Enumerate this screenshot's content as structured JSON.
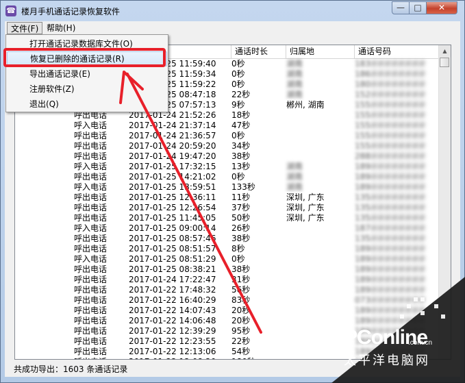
{
  "window": {
    "title": "楼月手机通话记录恢复软件",
    "app_icon": "phone-app-icon"
  },
  "window_controls": {
    "minimize": "—",
    "maximize": "□",
    "close": "✕"
  },
  "menubar": {
    "file": "文件(F)",
    "help": "帮助(H)"
  },
  "file_menu": {
    "items": [
      {
        "label": "打开通话记录数据库文件(O)"
      },
      {
        "label": "恢复已删除的通话记录(R)"
      },
      {
        "label": "导出通话记录(E)"
      },
      {
        "label": "注册软件(Z)"
      },
      {
        "label": "退出(Q)"
      }
    ],
    "highlighted_index": 1
  },
  "table": {
    "columns": [
      "通话时长",
      "归属地",
      "通话号码"
    ],
    "rows": [
      {
        "type": "",
        "time": "2017-01-25 11:59:40",
        "duration": "0秒",
        "location": "湖南",
        "number": "183"
      },
      {
        "type": "",
        "time": "2017-01-25 11:59:34",
        "duration": "0秒",
        "location": "湖南",
        "number": "186"
      },
      {
        "type": "",
        "time": "2017-01-25 11:59:22",
        "duration": "0秒",
        "location": "湖南",
        "number": "180"
      },
      {
        "type": "",
        "time": "2017-01-25 08:47:18",
        "duration": "22秒",
        "location": "湖南",
        "number": "152"
      },
      {
        "type": "",
        "time": "2017-01-25 07:57:13",
        "duration": "9秒",
        "location": "郴州, 湖南",
        "number": "155"
      },
      {
        "type": "呼出电话",
        "time": "2017-01-24 21:52:26",
        "duration": "18秒",
        "location": "",
        "number": "155"
      },
      {
        "type": "呼入电话",
        "time": "2017-01-24 21:37:14",
        "duration": "47秒",
        "location": "",
        "number": "155"
      },
      {
        "type": "呼出电话",
        "time": "2017-01-24 21:36:57",
        "duration": "0秒",
        "location": "",
        "number": "155"
      },
      {
        "type": "呼出电话",
        "time": "2017-01-24 20:59:20",
        "duration": "34秒",
        "location": "",
        "number": "155"
      },
      {
        "type": "呼出电话",
        "time": "2017-01-24 19:47:20",
        "duration": "38秒",
        "location": "",
        "number": "288"
      },
      {
        "type": "呼入电话",
        "time": "2017-01-25 17:32:15",
        "duration": "13秒",
        "location": "湖南",
        "number": "189"
      },
      {
        "type": "呼出电话",
        "time": "2017-01-25 14:21:02",
        "duration": "0秒",
        "location": "湖南",
        "number": "189"
      },
      {
        "type": "呼入电话",
        "time": "2017-01-25 13:59:51",
        "duration": "133秒",
        "location": "湖南",
        "number": "189"
      },
      {
        "type": "呼出电话",
        "time": "2017-01-25 12:36:11",
        "duration": "11秒",
        "location": "深圳, 广东",
        "number": "135"
      },
      {
        "type": "呼出电话",
        "time": "2017-01-25 12:26:54",
        "duration": "37秒",
        "location": "深圳, 广东",
        "number": "135"
      },
      {
        "type": "呼出电话",
        "time": "2017-01-25 11:45:05",
        "duration": "50秒",
        "location": "深圳, 广东",
        "number": "135"
      },
      {
        "type": "呼入电话",
        "time": "2017-01-25 09:00:14",
        "duration": "26秒",
        "location": "",
        "number": "187"
      },
      {
        "type": "呼出电话",
        "time": "2017-01-25 08:57:46",
        "duration": "38秒",
        "location": "",
        "number": "135"
      },
      {
        "type": "呼出电话",
        "time": "2017-01-25 08:51:57",
        "duration": "8秒",
        "location": "",
        "number": "189"
      },
      {
        "type": "呼入电话",
        "time": "2017-01-25 08:51:29",
        "duration": "0秒",
        "location": "",
        "number": "189"
      },
      {
        "type": "呼出电话",
        "time": "2017-01-25 08:38:21",
        "duration": "38秒",
        "location": "",
        "number": "189"
      },
      {
        "type": "呼出电话",
        "time": "2017-01-24 17:22:47",
        "duration": "31秒",
        "location": "",
        "number": "189"
      },
      {
        "type": "呼出电话",
        "time": "2017-01-22 17:48:32",
        "duration": "56秒",
        "location": "",
        "number": "189"
      },
      {
        "type": "呼出电话",
        "time": "2017-01-22 16:40:29",
        "duration": "83秒",
        "location": "",
        "number": "073"
      },
      {
        "type": "呼出电话",
        "time": "2017-01-22 14:07:43",
        "duration": "20秒",
        "location": "",
        "number": "189"
      },
      {
        "type": "呼出电话",
        "time": "2017-01-22 14:06:48",
        "duration": "20秒",
        "location": "",
        "number": "189"
      },
      {
        "type": "呼出电话",
        "time": "2017-01-22 12:39:29",
        "duration": "95秒",
        "location": "",
        "number": "189"
      },
      {
        "type": "呼出电话",
        "time": "2017-01-22 12:23:55",
        "duration": "22秒",
        "location": "",
        "number": "189"
      },
      {
        "type": "呼出电话",
        "time": "2017-01-22 12:13:06",
        "duration": "54秒",
        "location": "",
        "number": "189"
      },
      {
        "type": "呼出电话",
        "time": "2017-01-22 12:08:20",
        "duration": "180秒",
        "location": "",
        "number": "189"
      }
    ]
  },
  "statusbar": {
    "text": "共成功导出：1603 条通话记录"
  },
  "annotation": {
    "color": "#e8202a"
  },
  "watermark": {
    "brand": "PConline",
    "domain": ".com.cn",
    "cn": "太平洋电脑网"
  }
}
